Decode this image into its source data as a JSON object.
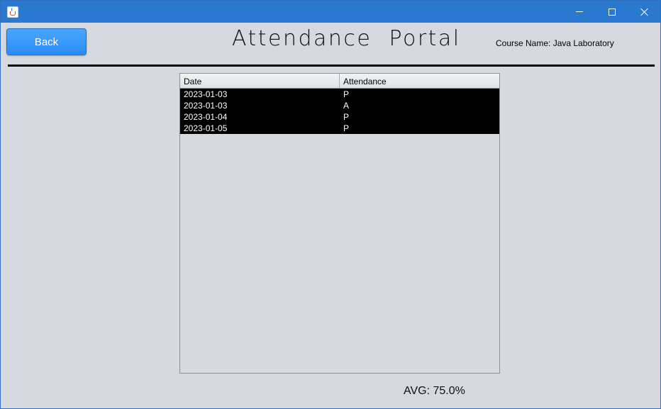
{
  "window": {
    "controls": {
      "minimize_icon": "minimize-icon",
      "maximize_icon": "maximize-icon",
      "close_icon": "close-icon"
    },
    "titlebar_color": "#2b78d0"
  },
  "header": {
    "back_label": "Back",
    "title": "Attendance  Portal",
    "course_label": "Course Name: Java Laboratory"
  },
  "table": {
    "columns": [
      "Date",
      "Attendance"
    ],
    "rows": [
      {
        "date": "2023-01-03",
        "attendance": "P"
      },
      {
        "date": "2023-01-03",
        "attendance": "A"
      },
      {
        "date": "2023-01-04",
        "attendance": "P"
      },
      {
        "date": "2023-01-05",
        "attendance": "P"
      }
    ]
  },
  "footer": {
    "avg_text": "AVG: 75.0%"
  },
  "colors": {
    "accent": "#2a8cf5",
    "background": "#d6d9e0",
    "row_selected": "#000000"
  }
}
